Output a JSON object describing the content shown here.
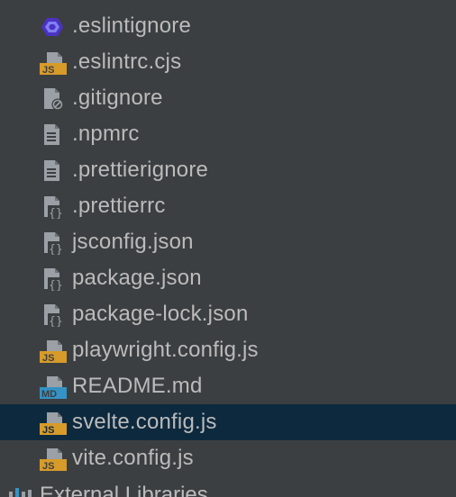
{
  "files": [
    {
      "name": ".eslintignore",
      "icon": "eslint-icon"
    },
    {
      "name": ".eslintrc.cjs",
      "icon": "js-file-icon"
    },
    {
      "name": ".gitignore",
      "icon": "ignore-file-icon"
    },
    {
      "name": ".npmrc",
      "icon": "text-file-icon"
    },
    {
      "name": ".prettierignore",
      "icon": "text-file-icon"
    },
    {
      "name": ".prettierrc",
      "icon": "json-file-icon"
    },
    {
      "name": "jsconfig.json",
      "icon": "json-file-icon"
    },
    {
      "name": "package.json",
      "icon": "json-file-icon"
    },
    {
      "name": "package-lock.json",
      "icon": "json-file-icon"
    },
    {
      "name": "playwright.config.js",
      "icon": "js-file-icon"
    },
    {
      "name": "README.md",
      "icon": "markdown-file-icon"
    },
    {
      "name": "svelte.config.js",
      "icon": "js-file-icon",
      "selected": true
    },
    {
      "name": "vite.config.js",
      "icon": "js-file-icon"
    }
  ],
  "external_libraries": {
    "label": "External Libraries",
    "icon": "libraries-icon"
  },
  "colors": {
    "background": "#3c3f41",
    "selection": "#0d293e",
    "text": "#bbbbbb",
    "js_badge": "#d79b2a",
    "md_badge": "#3592c4",
    "eslint": "#4b32c3",
    "file_gray": "#9aa0a6"
  }
}
